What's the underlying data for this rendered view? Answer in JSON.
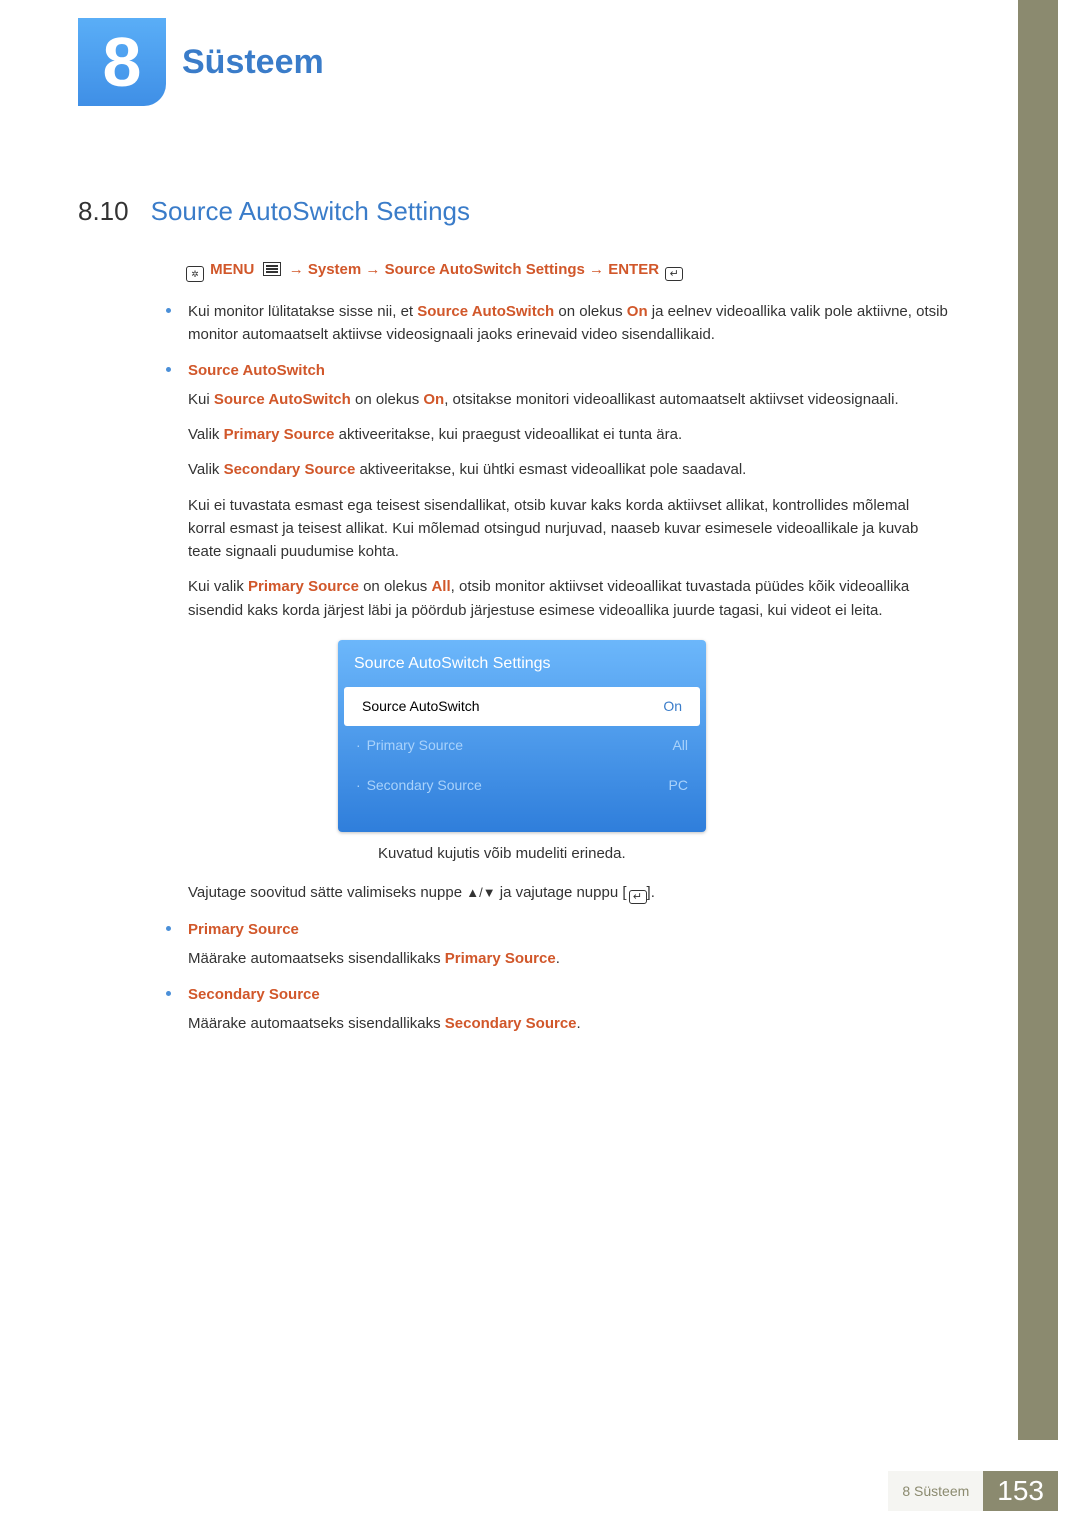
{
  "chapter": {
    "number": "8",
    "title": "Süsteem"
  },
  "section": {
    "number": "8.10",
    "title": "Source AutoSwitch Settings"
  },
  "breadcrumb": {
    "menu": "MENU",
    "system": "System",
    "target": "Source AutoSwitch Settings",
    "enter": "ENTER",
    "arrow": "→"
  },
  "intro": {
    "p1a": "Kui monitor lülitatakse sisse nii, et ",
    "p1b": "Source AutoSwitch",
    "p1c": " on olekus ",
    "p1d": "On",
    "p1e": " ja eelnev videoallika valik pole aktiivne, otsib monitor automaatselt aktiivse videosignaali jaoks erinevaid video sisendallikaid."
  },
  "sas": {
    "head": "Source AutoSwitch",
    "p1a": "Kui ",
    "p1b": "Source AutoSwitch",
    "p1c": " on olekus ",
    "p1d": "On",
    "p1e": ", otsitakse monitori videoallikast automaatselt aktiivset videosignaali.",
    "p2a": "Valik ",
    "p2b": "Primary Source",
    "p2c": " aktiveeritakse, kui praegust videoallikat ei tunta ära.",
    "p3a": "Valik ",
    "p3b": "Secondary Source",
    "p3c": " aktiveeritakse, kui ühtki esmast videoallikat pole saadaval.",
    "p4": "Kui ei tuvastata esmast ega teisest sisendallikat, otsib kuvar kaks korda aktiivset allikat, kontrollides mõlemal korral esmast ja teisest allikat. Kui mõlemad otsingud nurjuvad, naaseb kuvar esimesele videoallikale ja kuvab teate signaali puudumise kohta.",
    "p5a": "Kui valik ",
    "p5b": "Primary Source",
    "p5c": " on olekus ",
    "p5d": "All",
    "p5e": ", otsib monitor aktiivset videoallikat tuvastada püüdes kõik videoallika sisendid kaks korda järjest läbi ja pöördub järjestuse esimese videoallika juurde tagasi, kui videot ei leita."
  },
  "osd": {
    "title": "Source AutoSwitch Settings",
    "rows": [
      {
        "label": "Source AutoSwitch",
        "value": "On",
        "selected": true
      },
      {
        "label": "Primary Source",
        "value": "All",
        "sub": true
      },
      {
        "label": "Secondary Source",
        "value": "PC",
        "sub": true
      }
    ]
  },
  "caption": "Kuvatud kujutis võib mudeliti erineda.",
  "instr": {
    "a": "Vajutage soovitud sätte valimiseks nuppe ",
    "arrows": "▲/▼",
    "b": " ja vajutage nuppu ",
    "c": "."
  },
  "ps": {
    "head": "Primary Source",
    "p1a": "Määrake automaatseks sisendallikaks ",
    "p1b": "Primary Source",
    "p1c": "."
  },
  "ss": {
    "head": "Secondary Source",
    "p1a": "Määrake automaatseks sisendallikaks ",
    "p1b": "Secondary Source",
    "p1c": "."
  },
  "footer": {
    "label": "8 Süsteem",
    "page": "153"
  }
}
